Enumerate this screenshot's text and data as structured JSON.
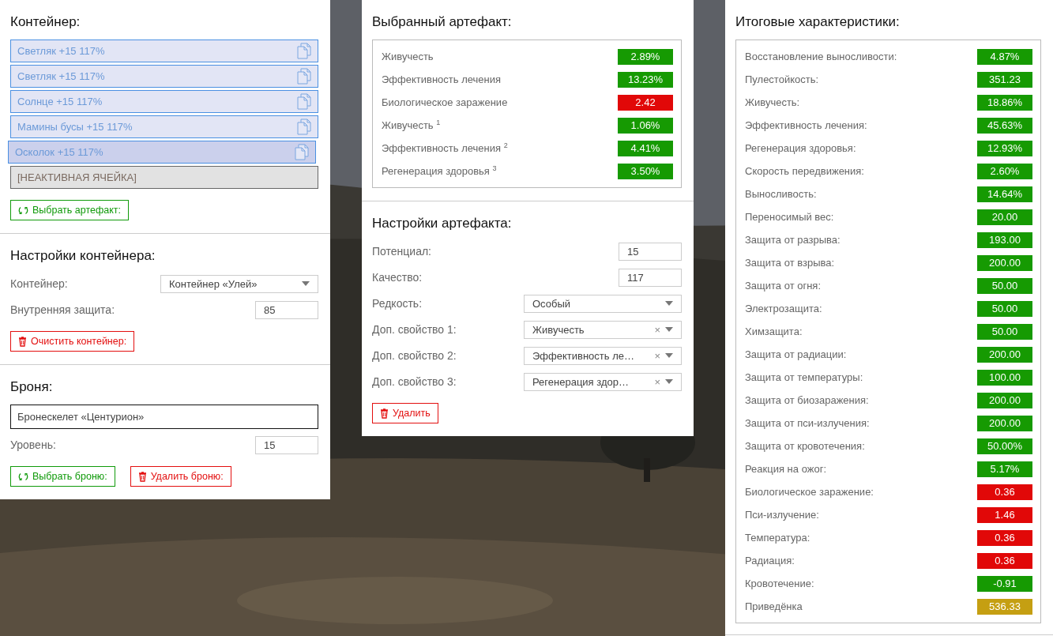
{
  "container": {
    "title": "Контейнер:",
    "slots": [
      {
        "kind": "artifact",
        "label": "Светляк +15 117%",
        "selected": false
      },
      {
        "kind": "artifact",
        "label": "Светляк +15 117%",
        "selected": false
      },
      {
        "kind": "artifact",
        "label": "Солнце +15 117%",
        "selected": false
      },
      {
        "kind": "artifact",
        "label": "Мамины бусы +15 117%",
        "selected": false
      },
      {
        "kind": "artifact",
        "label": "Осколок +15 117%",
        "selected": true
      },
      {
        "kind": "inactive",
        "label": "[НЕАКТИВНАЯ ЯЧЕЙКА]",
        "selected": false
      }
    ],
    "button": "Выбрать артефакт:"
  },
  "container_settings": {
    "title": "Настройки контейнера:",
    "fields": [
      {
        "kind": "select",
        "label": "Контейнер:",
        "value": "Контейнер «Улей»"
      },
      {
        "kind": "input",
        "label": "Внутренняя защита:",
        "value": "85"
      }
    ],
    "button": "Очистить контейнер:"
  },
  "armor": {
    "title": "Броня:",
    "name": "Бронескелет «Центурион»",
    "level_label": "Уровень:",
    "level_value": "15",
    "select_button": "Выбрать броню:",
    "delete_button": "Удалить броню:"
  },
  "selected_artifact": {
    "title": "Выбранный артефакт:",
    "stats": [
      {
        "label": "Живучесть",
        "value": "2.89%",
        "color": "#169a02"
      },
      {
        "label": "Эффективность лечения",
        "value": "13.23%",
        "color": "#169a02"
      },
      {
        "label": "Биологическое заражение",
        "value": "2.42",
        "color": "#e10808"
      },
      {
        "label": "Живучесть $^{1}$",
        "value": "1.06%",
        "color": "#169a02"
      },
      {
        "label": "Эффективность лечения $^{2}$",
        "value": "4.41%",
        "color": "#169a02"
      },
      {
        "label": "Регенерация здоровья $^{3}$",
        "value": "3.50%",
        "color": "#169a02"
      }
    ]
  },
  "artifact_settings": {
    "title": "Настройки артефакта:",
    "fields": [
      {
        "kind": "input",
        "label": "Потенциал:",
        "value": "15"
      },
      {
        "kind": "input",
        "label": "Качество:",
        "value": "117"
      },
      {
        "kind": "select",
        "label": "Редкость:",
        "value": "Особый"
      },
      {
        "kind": "select",
        "label": "Доп. свойство 1:",
        "value": "Живучесть",
        "clear_icon": "×"
      },
      {
        "kind": "select",
        "label": "Доп. свойство 2:",
        "value": "Эффективность ле…",
        "clear_icon": "×"
      },
      {
        "kind": "select",
        "label": "Доп. свойство 3:",
        "value": "Регенерация здор…",
        "clear_icon": "×"
      }
    ],
    "button": "Удалить"
  },
  "totals": {
    "title": "Итоговые характеристики:",
    "stats": [
      {
        "label": "Восстановление выносливости:",
        "value": "4.87%",
        "color": "#169a02"
      },
      {
        "label": "Пулестойкость:",
        "value": "351.23",
        "color": "#169a02"
      },
      {
        "label": "Живучесть:",
        "value": "18.86%",
        "color": "#169a02"
      },
      {
        "label": "Эффективность лечения:",
        "value": "45.63%",
        "color": "#169a02"
      },
      {
        "label": "Регенерация здоровья:",
        "value": "12.93%",
        "color": "#169a02"
      },
      {
        "label": "Скорость передвижения:",
        "value": "2.60%",
        "color": "#169a02"
      },
      {
        "label": "Выносливость:",
        "value": "14.64%",
        "color": "#169a02"
      },
      {
        "label": "Переносимый вес:",
        "value": "20.00",
        "color": "#169a02"
      },
      {
        "label": "Защита от разрыва:",
        "value": "193.00",
        "color": "#169a02"
      },
      {
        "label": "Защита от взрыва:",
        "value": "200.00",
        "color": "#169a02"
      },
      {
        "label": "Защита от огня:",
        "value": "50.00",
        "color": "#169a02"
      },
      {
        "label": "Электрозащита:",
        "value": "50.00",
        "color": "#169a02"
      },
      {
        "label": "Химзащита:",
        "value": "50.00",
        "color": "#169a02"
      },
      {
        "label": "Защита от радиации:",
        "value": "200.00",
        "color": "#169a02"
      },
      {
        "label": "Защита от температуры:",
        "value": "100.00",
        "color": "#169a02"
      },
      {
        "label": "Защита от биозаражения:",
        "value": "200.00",
        "color": "#169a02"
      },
      {
        "label": "Защита от пси-излучения:",
        "value": "200.00",
        "color": "#169a02"
      },
      {
        "label": "Защита от кровотечения:",
        "value": "50.00%",
        "color": "#169a02"
      },
      {
        "label": "Реакция на ожог:",
        "value": "5.17%",
        "color": "#169a02"
      },
      {
        "label": "Биологическое заражение:",
        "value": "0.36",
        "color": "#e10808"
      },
      {
        "label": "Пси-излучение:",
        "value": "1.46",
        "color": "#e10808"
      },
      {
        "label": "Температура:",
        "value": "0.36",
        "color": "#e10808"
      },
      {
        "label": "Радиация:",
        "value": "0.36",
        "color": "#e10808"
      },
      {
        "label": "Кровотечение:",
        "value": "-0.91",
        "color": "#169a02"
      },
      {
        "label": "Приведёнка",
        "value": "536.33",
        "color": "#c59f12"
      }
    ]
  }
}
